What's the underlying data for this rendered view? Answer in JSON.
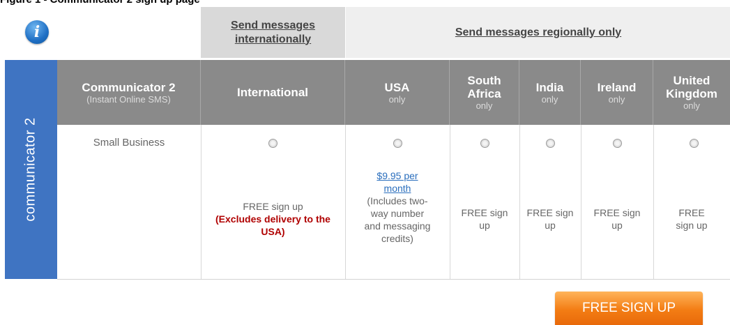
{
  "caption": "Figure 1 - Communicator 2 sign up page",
  "header": {
    "international_link": "Send messages internationally",
    "regional_link": "Send messages regionally only"
  },
  "sidebar": {
    "label": "communicator 2"
  },
  "columns": [
    {
      "title": "Communicator 2",
      "subtitle": "(Instant Online SMS)"
    },
    {
      "title": "International",
      "subtitle": ""
    },
    {
      "title": "USA",
      "subtitle": "only"
    },
    {
      "title": "South Africa",
      "subtitle": "only"
    },
    {
      "title": "India",
      "subtitle": "only"
    },
    {
      "title": "Ireland",
      "subtitle": "only"
    },
    {
      "title": "United Kingdom",
      "subtitle": "only"
    }
  ],
  "row": {
    "plan_name": "Small Business",
    "international": {
      "text": "FREE sign up",
      "note": "(Excludes delivery to the USA)"
    },
    "usa": {
      "price_link": "$9.95 per month",
      "details": "(Includes two-way number and messaging credits)"
    },
    "south_africa": "FREE sign up",
    "india": "FREE sign up",
    "ireland": "FREE sign up",
    "uk": "FREE sign up"
  },
  "signup_button": "FREE SIGN UP",
  "colors": {
    "sidebar": "#3f74c2",
    "header_gray": "#8a8a8a",
    "button_orange": "#f37d14",
    "note_red": "#b00000",
    "link_blue": "#2a6ebd"
  }
}
